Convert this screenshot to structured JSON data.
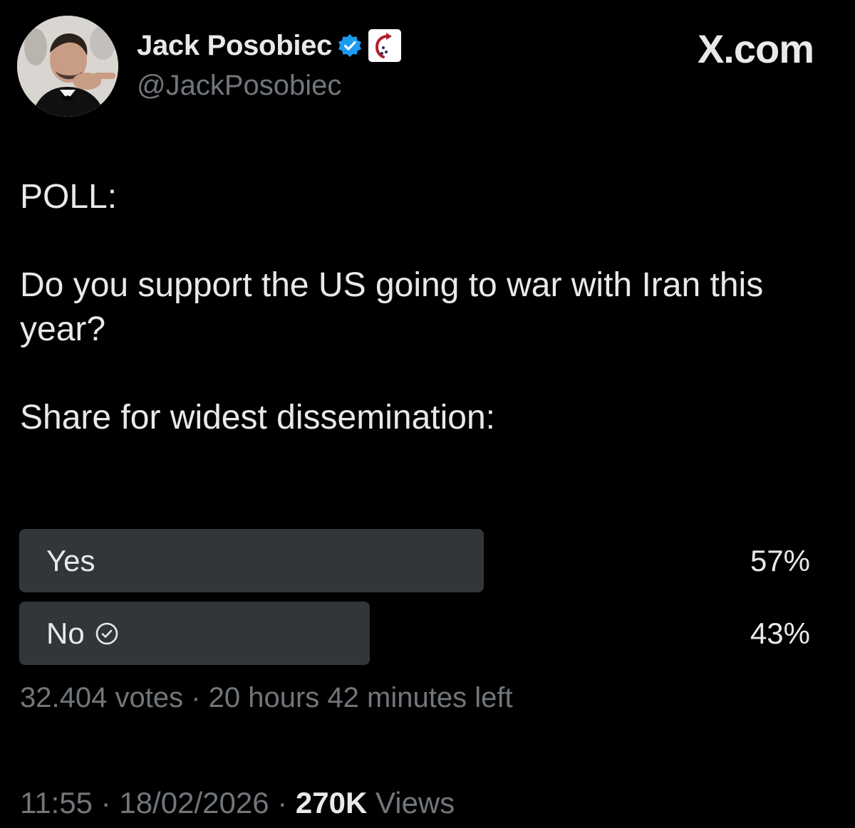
{
  "author": {
    "display_name": "Jack Posobiec",
    "handle": "@JackPosobiec"
  },
  "site_label": "X.com",
  "tweet": {
    "line_1": "POLL:",
    "line_2": "Do you support the US going to war with Iran this year?",
    "line_3": "Share for widest dissemination:"
  },
  "poll": {
    "options": [
      {
        "label": "Yes",
        "percent": "57%",
        "share": 0.57,
        "selected": false
      },
      {
        "label": "No",
        "percent": "43%",
        "share": 0.43,
        "selected": true
      }
    ],
    "votes": "32.404 votes",
    "separator": "·",
    "time_left": "20 hours 42 minutes left"
  },
  "footer": {
    "time": "11:55",
    "date": "18/02/2026",
    "separator": "·",
    "views_count": "270K",
    "views_label": "Views"
  },
  "colors": {
    "background": "#000000",
    "text_primary": "#e7e9ea",
    "text_secondary": "#71767b",
    "poll_bar": "#333639",
    "verified_badge": "#1d9bf0"
  },
  "icons": {
    "verified": "verified-badge-icon",
    "affiliation": "affiliation-badge-icon",
    "selected_option": "check-circle-icon"
  }
}
